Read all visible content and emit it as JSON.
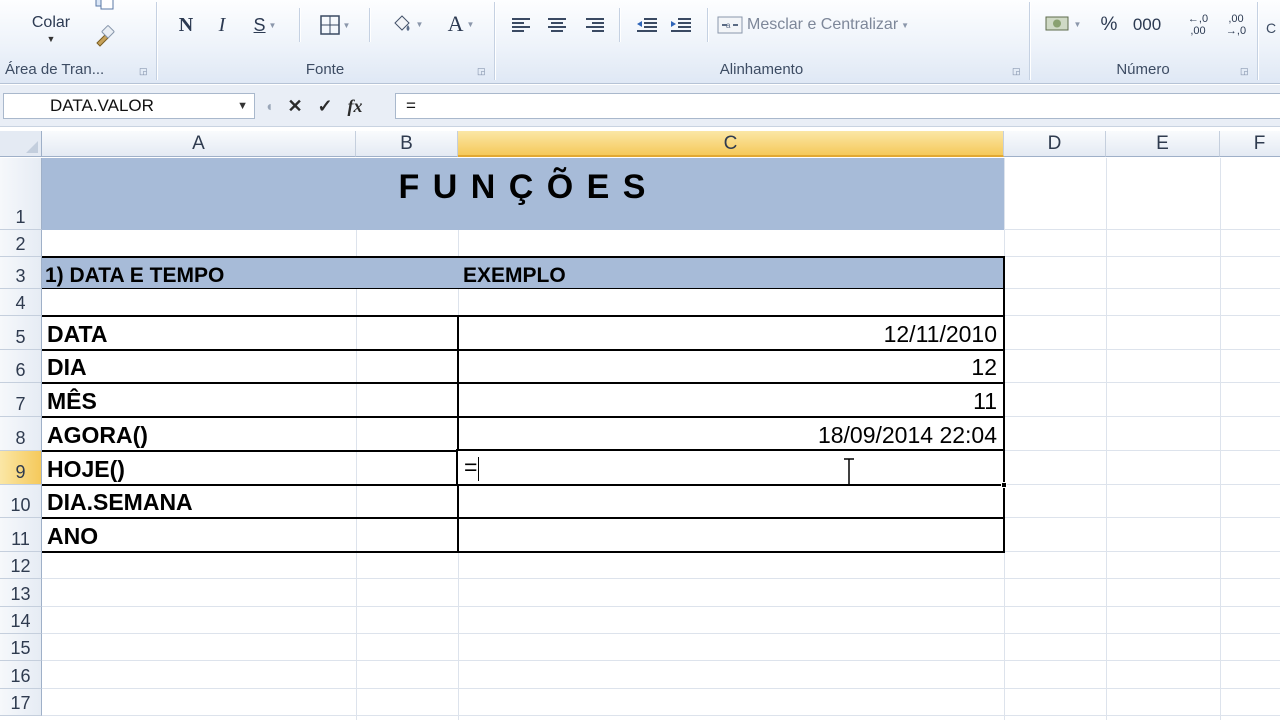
{
  "ribbon": {
    "clipboard": {
      "paste_label": "Colar",
      "group_label": "Área de Tran..."
    },
    "font": {
      "bold": "N",
      "italic": "I",
      "underline": "S",
      "group_label": "Fonte",
      "font_color_glyph": "A"
    },
    "alignment": {
      "merge_center_label": "Mesclar e Centralizar",
      "group_label": "Alinhamento"
    },
    "number": {
      "percent": "%",
      "thousands": "000",
      "increase_decimal_top": "←,0",
      "increase_decimal_bottom": ",00",
      "decrease_decimal_top": ",00",
      "decrease_decimal_bottom": "→,0",
      "group_label": "Número"
    }
  },
  "formula_bar": {
    "name_box": "DATA.VALOR",
    "cancel": "✕",
    "enter": "✓",
    "fx": "fx",
    "formula": "="
  },
  "columns": [
    "A",
    "B",
    "C",
    "D",
    "E",
    "F"
  ],
  "rows": [
    "1",
    "2",
    "3",
    "4",
    "5",
    "6",
    "7",
    "8",
    "9",
    "10",
    "11",
    "12",
    "13",
    "14",
    "15",
    "16",
    "17"
  ],
  "sheet": {
    "title": "F U N Ç Õ E S",
    "header_left": "1) DATA  E TEMPO",
    "header_right": "EXEMPLO",
    "items": [
      {
        "label": "DATA",
        "value": "12/11/2010"
      },
      {
        "label": "DIA",
        "value": "12"
      },
      {
        "label": "MÊS",
        "value": "11"
      },
      {
        "label": "AGORA()",
        "value": "18/09/2014 22:04"
      },
      {
        "label": "HOJE()",
        "value": "="
      },
      {
        "label": "DIA.SEMANA",
        "value": ""
      },
      {
        "label": "ANO",
        "value": ""
      }
    ]
  },
  "colors": {
    "band": "#a7bbd8",
    "selected_header": "#f5c95b",
    "gridline": "#dde3ec"
  }
}
